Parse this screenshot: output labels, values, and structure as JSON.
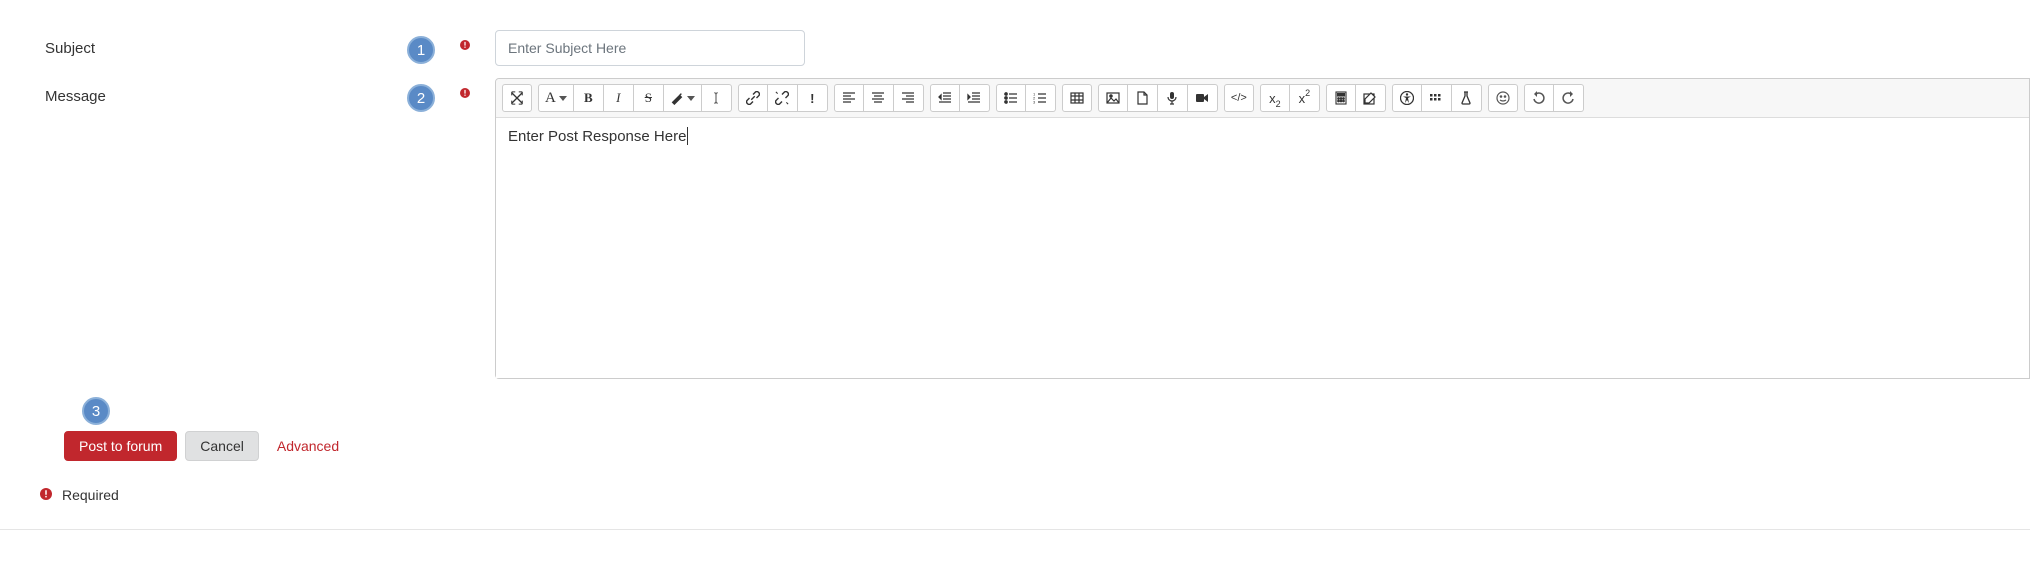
{
  "callouts": {
    "subject": "1",
    "message": "2",
    "submit": "3"
  },
  "labels": {
    "subject": "Subject",
    "message": "Message"
  },
  "subject": {
    "placeholder": "Enter Subject Here",
    "value": ""
  },
  "message": {
    "text": "Enter Post Response Here"
  },
  "toolbar": {
    "fullscreen": "Fullscreen",
    "font": "A",
    "bold": "B",
    "italic": "I",
    "strike": "S",
    "color": "Color",
    "clear_format": "Clear formatting",
    "link": "Link",
    "unlink": "Unlink",
    "no_autolink": "!",
    "align_left": "Align left",
    "align_center": "Align center",
    "align_right": "Align right",
    "outdent": "Outdent",
    "indent": "Indent",
    "ul": "Unordered list",
    "ol": "Ordered list",
    "table": "Table",
    "image": "Image",
    "file": "File",
    "audio": "Audio",
    "video": "Video",
    "html": "</>",
    "sub": "x",
    "sub_suffix": "2",
    "sup": "x",
    "sup_suffix": "2",
    "calc": "Calculator",
    "edit": "Edit",
    "accessibility": "Accessibility",
    "grid": "Grid",
    "flask": "Flask",
    "emoji": "Emoji",
    "undo": "Undo",
    "redo": "Redo"
  },
  "actions": {
    "post": "Post to forum",
    "cancel": "Cancel",
    "advanced": "Advanced"
  },
  "required_note": "Required"
}
